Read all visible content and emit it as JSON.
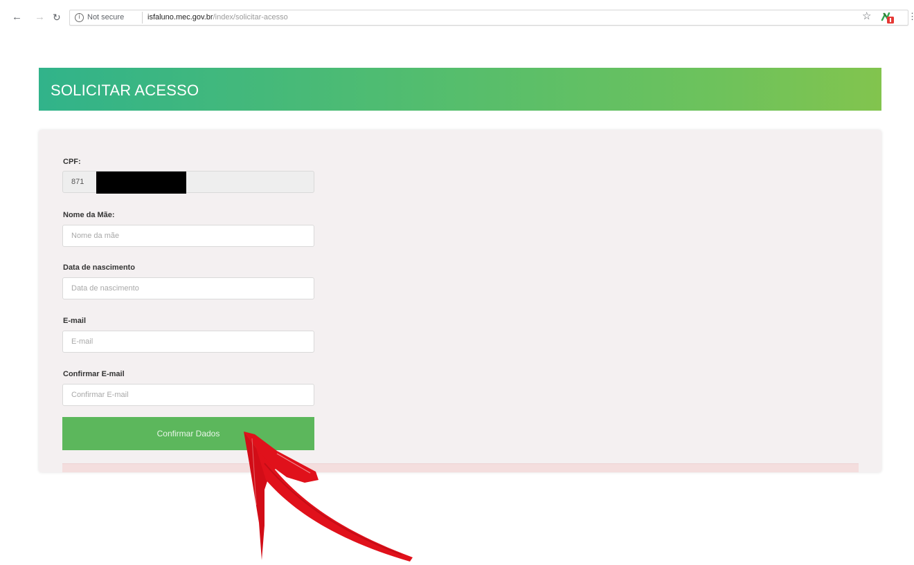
{
  "browser": {
    "security_label": "Not secure",
    "url_host": "isfaluno.mec.gov.br",
    "url_path": "/index/solicitar-acesso"
  },
  "page": {
    "title": "SOLICITAR ACESSO"
  },
  "form": {
    "cpf": {
      "label": "CPF:",
      "value": "871"
    },
    "nome_mae": {
      "label": "Nome da Mãe:",
      "placeholder": "Nome da mãe"
    },
    "data_nascimento": {
      "label": "Data de nascimento",
      "placeholder": "Data de nascimento"
    },
    "email": {
      "label": "E-mail",
      "placeholder": "E-mail"
    },
    "confirmar_email": {
      "label": "Confirmar E-mail",
      "placeholder": "Confirmar E-mail"
    },
    "submit_label": "Confirmar Dados"
  },
  "colors": {
    "header_gradient_start": "#31b38a",
    "header_gradient_end": "#82c44e",
    "button": "#5cb75c",
    "card_bg": "#f4f0f1",
    "annotation_arrow": "#e0111b"
  },
  "icons": [
    "back-arrow-icon",
    "forward-arrow-icon",
    "reload-icon",
    "info-icon",
    "star-icon",
    "extension-icon",
    "menu-icon",
    "red-arrow-annotation"
  ]
}
